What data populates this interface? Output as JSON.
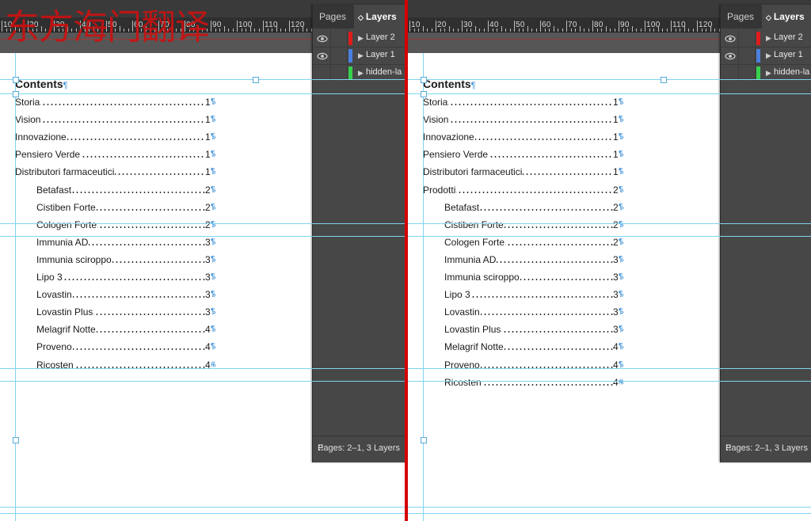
{
  "watermark": "东方海门翻译",
  "ruler": {
    "ticks": [
      "10",
      "20",
      "30",
      "40",
      "50",
      "60",
      "70",
      "80",
      "90",
      "100",
      "110",
      "120"
    ]
  },
  "colors": {
    "layer2": "#e01b1b",
    "layer1": "#4a7fe0",
    "hidden": "#36d14b",
    "divider": "#d40000",
    "guide": "#7fd4f0"
  },
  "left": {
    "panel": {
      "tab_pages": "Pages",
      "tab_layers": "Layers",
      "layers": [
        {
          "name": "Layer 2",
          "visible": true,
          "color": "red"
        },
        {
          "name": "Layer 1",
          "visible": true,
          "color": "blue"
        },
        {
          "name": "hidden-la",
          "visible": false,
          "color": "green"
        }
      ],
      "footer": "Pages: 2–1, 3 Layers"
    },
    "toc": {
      "title": "Contents",
      "entries": [
        {
          "label": "Storia",
          "page": "1",
          "indent": false
        },
        {
          "label": "Vision",
          "page": "1",
          "indent": false
        },
        {
          "label": "Innovazione",
          "page": "1",
          "indent": false
        },
        {
          "label": "Pensiero Verde",
          "page": "1",
          "indent": false
        },
        {
          "label": "Distributori farmaceutici",
          "page": "1",
          "indent": false
        },
        {
          "label": "Betafast",
          "page": "2",
          "indent": true
        },
        {
          "label": "Cistiben Forte",
          "page": "2",
          "indent": true
        },
        {
          "label": "Cologen Forte",
          "page": "2",
          "indent": true
        },
        {
          "label": "Immunia AD",
          "page": "3",
          "indent": true
        },
        {
          "label": "Immunia sciroppo",
          "page": "3",
          "indent": true
        },
        {
          "label": "Lipo 3",
          "page": "3",
          "indent": true
        },
        {
          "label": "Lovastin",
          "page": "3",
          "indent": true
        },
        {
          "label": "Lovastin Plus",
          "page": "3",
          "indent": true
        },
        {
          "label": "Melagrif Notte",
          "page": "4",
          "indent": true
        },
        {
          "label": "Proveno",
          "page": "4",
          "indent": true
        },
        {
          "label": "Ricosten",
          "page": "4",
          "indent": true
        }
      ]
    }
  },
  "right": {
    "panel": {
      "tab_pages": "Pages",
      "tab_layers": "Layers",
      "layers": [
        {
          "name": "Layer 2",
          "visible": true,
          "color": "red"
        },
        {
          "name": "Layer 1",
          "visible": true,
          "color": "blue"
        },
        {
          "name": "hidden-la",
          "visible": false,
          "color": "green"
        }
      ],
      "footer": "Pages: 2–1, 3 Layers"
    },
    "toc": {
      "title": "Contents",
      "entries": [
        {
          "label": "Storia",
          "page": "1",
          "indent": false
        },
        {
          "label": "Vision",
          "page": "1",
          "indent": false
        },
        {
          "label": "Innovazione",
          "page": "1",
          "indent": false
        },
        {
          "label": "Pensiero Verde",
          "page": "1",
          "indent": false
        },
        {
          "label": "Distributori farmaceutici",
          "page": "1",
          "indent": false
        },
        {
          "label": "Prodotti",
          "page": "2",
          "indent": false
        },
        {
          "label": "Betafast",
          "page": "2",
          "indent": true
        },
        {
          "label": "Cistiben Forte",
          "page": "2",
          "indent": true
        },
        {
          "label": "Cologen Forte",
          "page": "2",
          "indent": true
        },
        {
          "label": "Immunia AD",
          "page": "3",
          "indent": true
        },
        {
          "label": "Immunia sciroppo",
          "page": "3",
          "indent": true
        },
        {
          "label": "Lipo 3",
          "page": "3",
          "indent": true
        },
        {
          "label": "Lovastin",
          "page": "3",
          "indent": true
        },
        {
          "label": "Lovastin Plus",
          "page": "3",
          "indent": true
        },
        {
          "label": "Melagrif Notte",
          "page": "4",
          "indent": true
        },
        {
          "label": "Proveno",
          "page": "4",
          "indent": true
        },
        {
          "label": "Ricosten",
          "page": "4",
          "indent": true
        }
      ]
    }
  }
}
